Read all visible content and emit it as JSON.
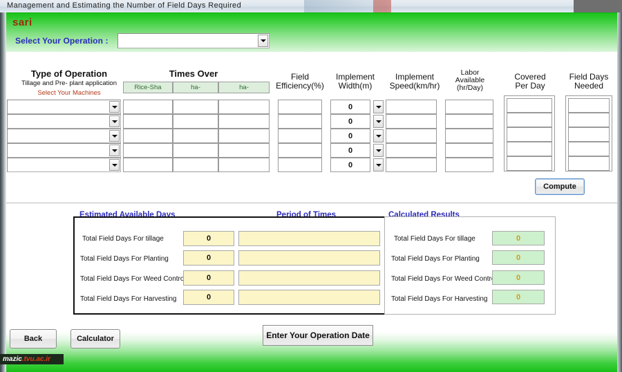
{
  "window": {
    "title": "Management and Estimating the Number of Field Days Required",
    "logo": "sari"
  },
  "operation": {
    "label": "Select Your Operation :",
    "value": "",
    "placeholder": ""
  },
  "table": {
    "group_headers": {
      "type_of_operation": "Type of Operation",
      "type_sub": "Tillage and Pre- plant application",
      "type_select": "Select Your Machines",
      "times_over": "Times Over"
    },
    "times_over_units": [
      "Rice-Sha",
      "ha-",
      "ha-"
    ],
    "columns": [
      {
        "line1": "Field",
        "line2": "Efficiency(%)"
      },
      {
        "line1": "Implement",
        "line2": "Width(m)"
      },
      {
        "line1": "Implement",
        "line2": "Speed(km/hr)"
      },
      {
        "line1": "Labor",
        "line2": "Available",
        "line3": "(hr/Day)"
      },
      {
        "line1": "Covered",
        "line2": "Per Day"
      },
      {
        "line1": "Field Days",
        "line2": "Needed"
      }
    ],
    "rows": [
      {
        "machine": "",
        "times1": "",
        "times2": "",
        "times3": "",
        "efficiency": "",
        "width": "0",
        "speed": "",
        "labor": "",
        "covered": "",
        "needed": ""
      },
      {
        "machine": "",
        "times1": "",
        "times2": "",
        "times3": "",
        "efficiency": "",
        "width": "0",
        "speed": "",
        "labor": "",
        "covered": "",
        "needed": ""
      },
      {
        "machine": "",
        "times1": "",
        "times2": "",
        "times3": "",
        "efficiency": "",
        "width": "0",
        "speed": "",
        "labor": "",
        "covered": "",
        "needed": ""
      },
      {
        "machine": "",
        "times1": "",
        "times2": "",
        "times3": "",
        "efficiency": "",
        "width": "0",
        "speed": "",
        "labor": "",
        "covered": "",
        "needed": ""
      },
      {
        "machine": "",
        "times1": "",
        "times2": "",
        "times3": "",
        "efficiency": "",
        "width": "0",
        "speed": "",
        "labor": "",
        "covered": "",
        "needed": ""
      }
    ],
    "compute_label": "Compute"
  },
  "estimated": {
    "group_label": "Estimated Available Days",
    "period_label": "Period  of  Times",
    "rows": [
      {
        "label": "Total Field Days For tillage",
        "value": "0",
        "period": ""
      },
      {
        "label": "Total Field Days For Planting",
        "value": "0",
        "period": ""
      },
      {
        "label": "Total Field Days For Weed Control",
        "value": "0",
        "period": ""
      },
      {
        "label": "Total Field Days For Harvesting",
        "value": "0",
        "period": ""
      }
    ]
  },
  "calculated": {
    "group_label": "Calculated Results",
    "rows": [
      {
        "label": "Total Field Days For tillage",
        "value": "0"
      },
      {
        "label": "Total Field Days For Planting",
        "value": "0"
      },
      {
        "label": "Total Field Days For Weed Control",
        "value": "0"
      },
      {
        "label": "Total Field Days For Harvesting",
        "value": "0"
      }
    ]
  },
  "footer": {
    "back": "Back",
    "calculator": "Calculator",
    "enter_date": "Enter Your Operation Date"
  },
  "watermark": {
    "part1": "mazic",
    "part2": ".tvu.ac.ir"
  },
  "colors": {
    "header_green": "#19c219",
    "logo_red": "#9d2b0b",
    "label_blue": "#2b2bbb",
    "yellow_field": "#fbf5c8",
    "green_field": "#cdf0cd",
    "result_text": "#d39a1a"
  }
}
